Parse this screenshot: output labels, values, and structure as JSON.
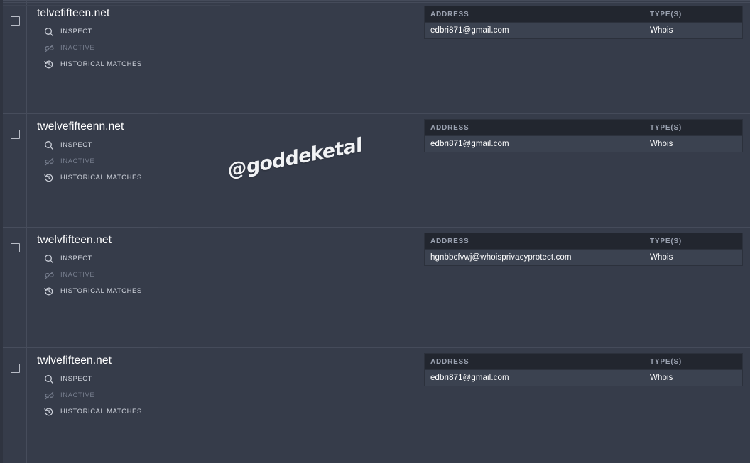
{
  "watermark": {
    "text": "@goddeketal"
  },
  "table": {
    "columns": {
      "address": "ADDRESS",
      "types": "TYPE(S)"
    }
  },
  "actions": {
    "inspect": "INSPECT",
    "inactive": "INACTIVE",
    "historical": "HISTORICAL MATCHES"
  },
  "colors": {
    "background": "#363c4a",
    "row_divider": "#454b5a",
    "table_header_bg": "#22262f",
    "table_body_bg": "#3b4250",
    "text_primary": "#ffffff",
    "text_muted": "#767d8d",
    "text_header": "#9aa1b0",
    "checkbox_border": "#b9bdc7"
  },
  "rows": [
    {
      "domain": "telvefifteen.net",
      "addresses": [
        {
          "address": "edbri871@gmail.com",
          "types": "Whois"
        }
      ]
    },
    {
      "domain": "twelvefifteenn.net",
      "addresses": [
        {
          "address": "edbri871@gmail.com",
          "types": "Whois"
        }
      ]
    },
    {
      "domain": "twelvfifteen.net",
      "addresses": [
        {
          "address": "hgnbbcfvwj@whoisprivacyprotect.com",
          "types": "Whois"
        }
      ]
    },
    {
      "domain": "twlvefifteen.net",
      "addresses": [
        {
          "address": "edbri871@gmail.com",
          "types": "Whois"
        }
      ]
    }
  ]
}
